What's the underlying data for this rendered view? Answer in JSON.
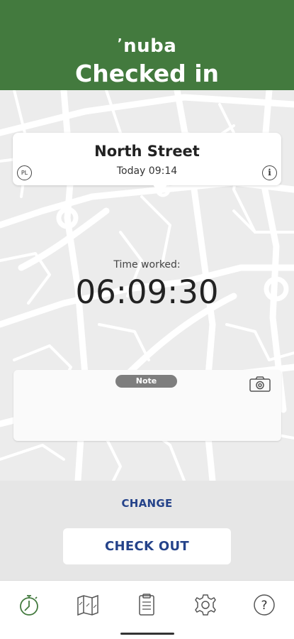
{
  "header": {
    "brand": "nuba",
    "title": "Checked in",
    "color": "#437a3e"
  },
  "location_card": {
    "name": "North Street",
    "time": "Today 09:14",
    "badge": "PL",
    "info_icon": "info-icon"
  },
  "time_worked": {
    "label": "Time worked:",
    "value": "06:09:30"
  },
  "note": {
    "tag": "Note",
    "camera_icon": "camera-icon"
  },
  "actions": {
    "change_label": "CHANGE",
    "checkout_label": "CHECK OUT",
    "accent_color": "#25438a"
  },
  "nav": {
    "items": [
      {
        "icon": "stopwatch-icon",
        "active": true
      },
      {
        "icon": "map-icon",
        "active": false
      },
      {
        "icon": "clipboard-icon",
        "active": false
      },
      {
        "icon": "gear-icon",
        "active": false
      },
      {
        "icon": "help-icon",
        "active": false
      }
    ],
    "active_color": "#437a3e"
  }
}
